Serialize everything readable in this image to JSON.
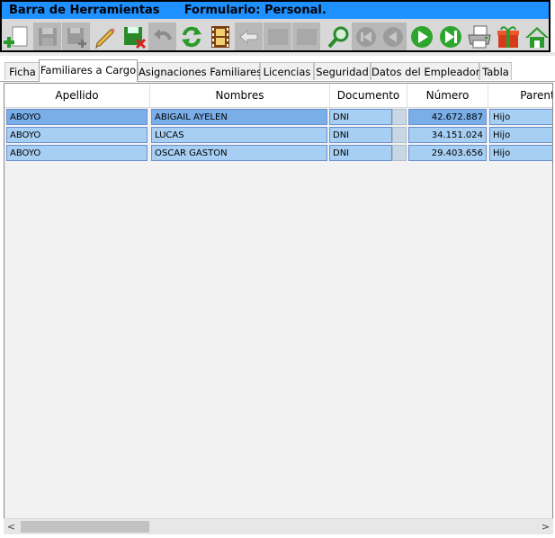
{
  "toolbar": {
    "title": "Barra de Herramientas      Formulario: Personal.",
    "icons": [
      {
        "name": "add-record-icon",
        "enabled": true
      },
      {
        "name": "save-icon",
        "enabled": false
      },
      {
        "name": "save-add-icon",
        "enabled": false
      },
      {
        "name": "edit-pencil-icon",
        "enabled": true
      },
      {
        "name": "save-delete-icon",
        "enabled": true
      },
      {
        "name": "undo-icon",
        "enabled": false
      },
      {
        "name": "refresh-icon",
        "enabled": true
      },
      {
        "name": "film-icon",
        "enabled": true
      },
      {
        "name": "back-arrow-icon",
        "enabled": false
      },
      {
        "name": "blank-icon-1",
        "enabled": false
      },
      {
        "name": "blank-icon-2",
        "enabled": false
      },
      {
        "name": "search-icon",
        "enabled": true
      },
      {
        "name": "first-record-icon",
        "enabled": false
      },
      {
        "name": "previous-record-icon",
        "enabled": false
      },
      {
        "name": "next-record-icon",
        "enabled": true
      },
      {
        "name": "last-record-icon",
        "enabled": true
      },
      {
        "name": "printer-icon",
        "enabled": true
      },
      {
        "name": "gift-icon",
        "enabled": true
      },
      {
        "name": "home-icon",
        "enabled": true
      }
    ]
  },
  "tabs": [
    {
      "label": "Ficha",
      "active": false
    },
    {
      "label": "Familiares a Cargo",
      "active": true
    },
    {
      "label": "Asignaciones Familiares",
      "active": false
    },
    {
      "label": "Licencias",
      "active": false
    },
    {
      "label": "Seguridad",
      "active": false
    },
    {
      "label": "Datos del Empleador",
      "active": false
    },
    {
      "label": "Tabla",
      "active": false
    }
  ],
  "grid": {
    "columns": [
      "Apellido",
      "Nombres",
      "Documento",
      "Número",
      "Parent"
    ],
    "rows": [
      {
        "apellido": "ABOYO",
        "nombres": "ABIGAIL AYELEN",
        "documento": "DNI",
        "numero": "42.672.887",
        "parentesco": "Hijo",
        "selected": true
      },
      {
        "apellido": "ABOYO",
        "nombres": "LUCAS",
        "documento": "DNI",
        "numero": "34.151.024",
        "parentesco": "Hijo",
        "selected": false
      },
      {
        "apellido": "ABOYO",
        "nombres": "OSCAR GASTON",
        "documento": "DNI",
        "numero": "29.403.656",
        "parentesco": "Hijo",
        "selected": false
      }
    ]
  },
  "scrollbar": {
    "left_arrow": "<",
    "right_arrow": ">"
  },
  "colors": {
    "title_bar": "#1e90ff",
    "row_fill": "#a7cff3",
    "row_selected": "#7aaee8",
    "disabled_button": "#b8b8b8"
  }
}
